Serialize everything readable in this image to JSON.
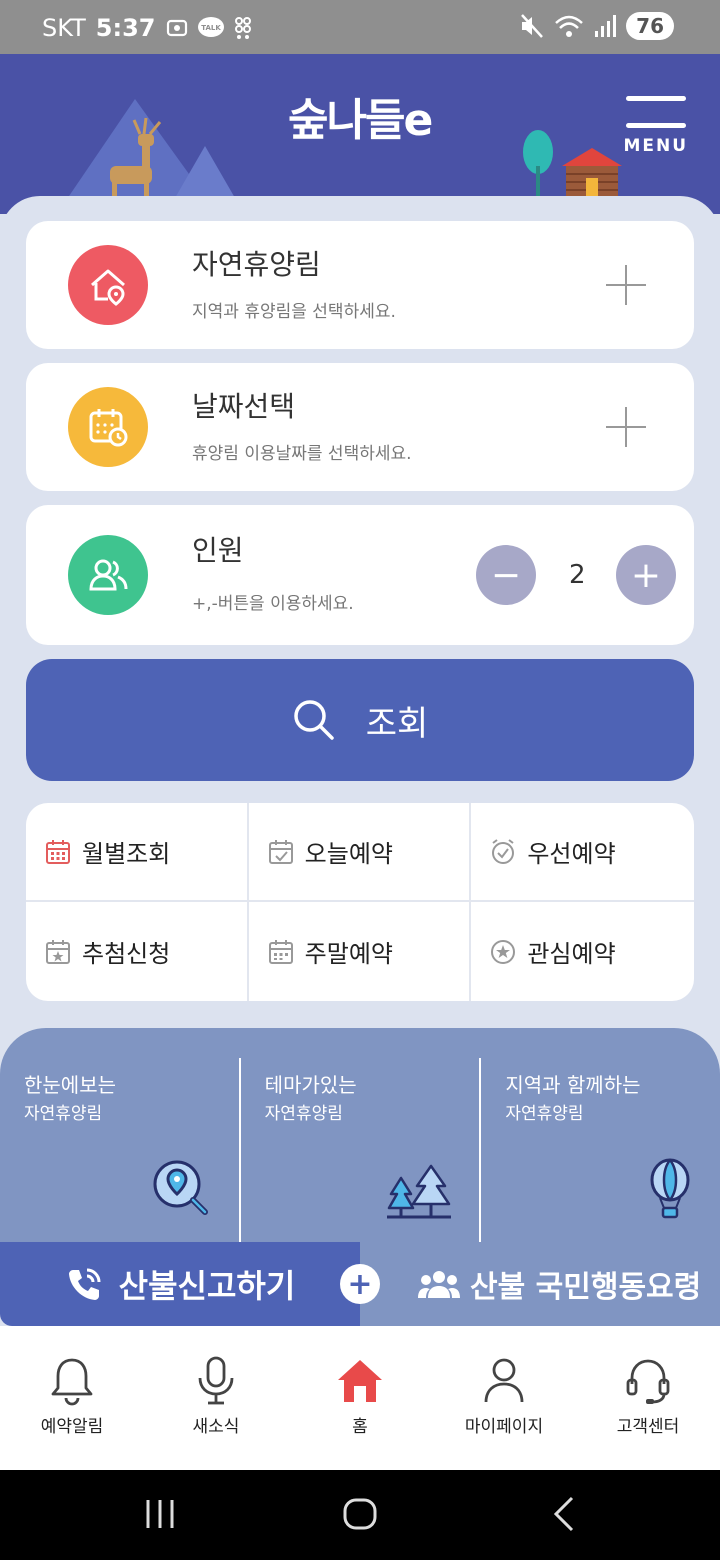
{
  "status_bar": {
    "carrier": "SKT",
    "time": "5:37",
    "talk_badge": "TALK",
    "battery": "76"
  },
  "header": {
    "logo_text": "숲나들e",
    "menu_label": "MENU"
  },
  "forest_card": {
    "title": "자연휴양림",
    "hint": "지역과 휴양림을 선택하세요.",
    "color": "#ee5a63"
  },
  "date_card": {
    "title": "날짜선택",
    "hint": "휴양림 이용날짜를 선택하세요.",
    "color": "#f6b93b"
  },
  "people_card": {
    "title": "인원",
    "hint": "+,-버튼을 이용하세요.",
    "count": "2",
    "color": "#3fc48f",
    "minus": "−",
    "plus": "+"
  },
  "search_button": {
    "label": "조회",
    "color": "#4e63b5"
  },
  "quick_menu": [
    {
      "label": "월별조회",
      "icon": "calendar-month-icon"
    },
    {
      "label": "오늘예약",
      "icon": "calendar-check-icon"
    },
    {
      "label": "우선예약",
      "icon": "alarm-check-icon"
    },
    {
      "label": "추첨신청",
      "icon": "calendar-star-icon"
    },
    {
      "label": "주말예약",
      "icon": "calendar-weekend-icon"
    },
    {
      "label": "관심예약",
      "icon": "star-circle-icon"
    }
  ],
  "themes": [
    {
      "title": "한눈에보는",
      "subtitle": "자연휴양림",
      "icon": "map-search-icon"
    },
    {
      "title": "테마가있는",
      "subtitle": "자연휴양림",
      "icon": "trees-icon"
    },
    {
      "title": "지역과 함께하는",
      "subtitle": "자연휴양림",
      "icon": "balloon-icon"
    }
  ],
  "fire": {
    "report_label": "산불신고하기",
    "plus": "+",
    "guide_label": "산불 국민행동요령"
  },
  "bottom_nav": [
    {
      "label": "예약알림",
      "icon": "bell-icon"
    },
    {
      "label": "새소식",
      "icon": "microphone-icon"
    },
    {
      "label": "홈",
      "icon": "home-icon"
    },
    {
      "label": "마이페이지",
      "icon": "person-icon"
    },
    {
      "label": "고객센터",
      "icon": "headset-icon"
    }
  ]
}
